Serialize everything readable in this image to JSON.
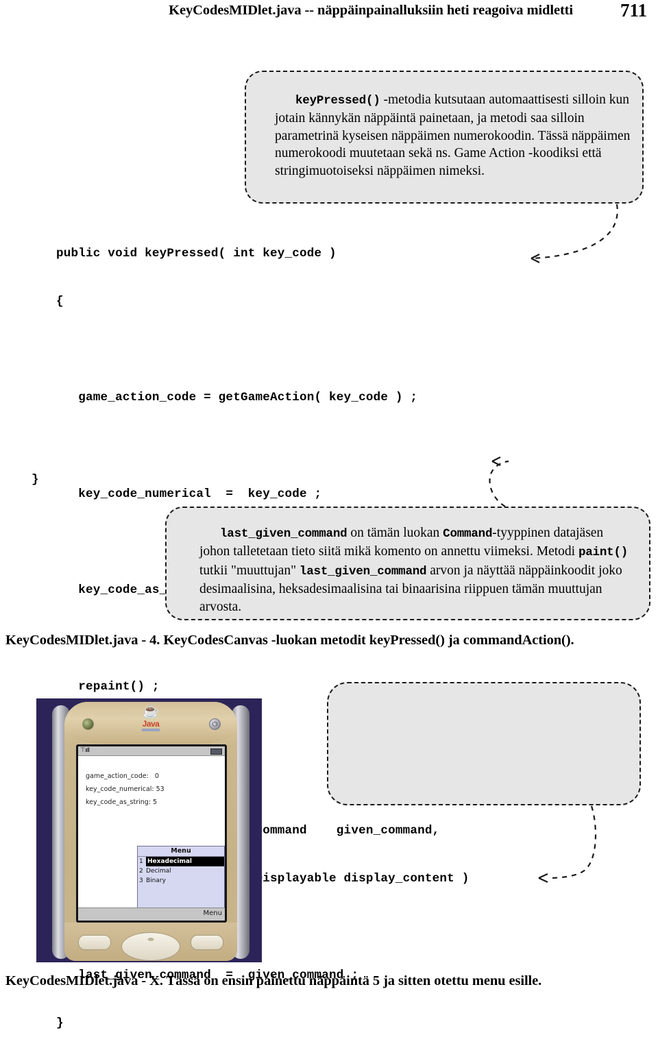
{
  "header": {
    "title": "KeyCodesMIDlet.java -- näppäinpainalluksiin heti reagoiva midletti",
    "page_number": "711"
  },
  "callout_top": {
    "code_term": "keyPressed()",
    "text": " -metodia kutsutaan automaattisesti silloin kun jotain kännykän näppäintä painetaan, ja metodi saa silloin parametrinä kyseisen näppäimen numerokoodin. Tässä näppäimen numerokoodi muutetaan sekä ns. Game Action -koodiksi että stringimuotoiseksi näppäimen nimeksi."
  },
  "code": {
    "lines": [
      "public void keyPressed( int key_code )",
      "{",
      "",
      "   game_action_code = getGameAction( key_code ) ;",
      "",
      "   key_code_numerical  =  key_code ;",
      "",
      "   key_code_as_string  =  getKeyName( key_code ) ;",
      "",
      "   repaint() ;",
      "}",
      "",
      "public void commandAction( Command    given_command,",
      "                           Displayable display_content )",
      "{",
      "   last_given_command  =  given_command ;",
      "}"
    ],
    "closing_brace": "}"
  },
  "callout_bottom": {
    "seg1": "last_given_command",
    "seg2": " on tämän luokan ",
    "seg3": "Command",
    "seg4": "-tyyppinen datajäsen johon talletetaan tieto siitä mikä komento on annettu viimeksi. Metodi ",
    "seg5": "paint()",
    "seg6": " tutkii \"muuttujan\" ",
    "seg7": "last_given_command",
    "seg8": " arvon ja näyttää näppäinkoodit joko desimaalisina, heksadesimaalisina tai binaarisina riippuen tämän muuttujan arvosta."
  },
  "captions": {
    "figure_4": "KeyCodesMIDlet.java - 4.  KeyCodesCanvas -luokan metodit keyPressed() ja commandAction().",
    "figure_x": "KeyCodesMIDlet.java - X.  Tässä on ensin painettu näppäintä 5 ja sitten otettu menu esille."
  },
  "phone": {
    "brand": "Java",
    "brand_sub": "POWERED",
    "power_glyph": "⏻",
    "signal_glyph": "⊤ııII",
    "canvas_lines": [
      "game_action_code:   0",
      "key_code_numerical: 53",
      "key_code_as_string: 5"
    ],
    "menu": {
      "title": "Menu",
      "items": [
        {
          "number": "1",
          "label": "Hexadecimal",
          "selected": true
        },
        {
          "number": "2",
          "label": "Decimal",
          "selected": false
        },
        {
          "number": "3",
          "label": "Binary",
          "selected": false
        }
      ]
    },
    "softkey_right": "Menu"
  },
  "colors": {
    "callout_fill": "#e6e6e6",
    "callout_border": "#1a1a1a",
    "phone_background": "#2c2458",
    "phone_shell": "#cbb88f",
    "menu_fill": "#d6d8f2",
    "selection": "#000000"
  }
}
